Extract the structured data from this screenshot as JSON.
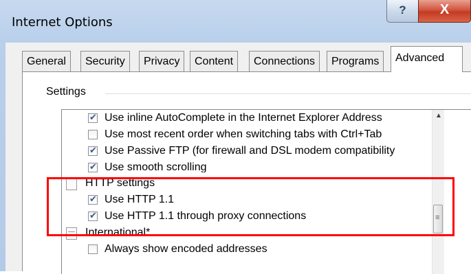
{
  "window": {
    "title": "Internet Options",
    "help_label": "?",
    "close_label": "X"
  },
  "tabs": [
    {
      "label": "General"
    },
    {
      "label": "Security"
    },
    {
      "label": "Privacy"
    },
    {
      "label": "Content"
    },
    {
      "label": "Connections"
    },
    {
      "label": "Programs"
    },
    {
      "label": "Advanced",
      "selected": true
    }
  ],
  "settings": {
    "group_label": "Settings",
    "items": [
      {
        "label": "Use inline AutoComplete in the Internet Explorer Address",
        "checked": true
      },
      {
        "label": "Use most recent order when switching tabs with Ctrl+Tab",
        "checked": false
      },
      {
        "label": "Use Passive FTP (for firewall and DSL modem compatibility",
        "checked": true
      },
      {
        "label": "Use smooth scrolling",
        "checked": true
      },
      {
        "label": "HTTP settings",
        "category": true
      },
      {
        "label": "Use HTTP 1.1",
        "checked": true
      },
      {
        "label": "Use HTTP 1.1 through proxy connections",
        "checked": true
      },
      {
        "label": "International*",
        "category": true
      },
      {
        "label": "Always show encoded addresses",
        "checked": false
      }
    ]
  },
  "scrollbar": {
    "up_glyph": "▲",
    "thumb_glyph": "≡"
  },
  "colors": {
    "highlight_box": "#ff0000",
    "close_button": "#c43b22",
    "title_bar": "#b9cfeb"
  }
}
